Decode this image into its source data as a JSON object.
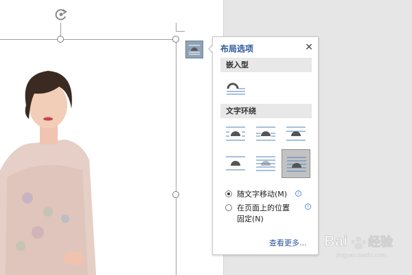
{
  "panel": {
    "title": "布局选项",
    "close_icon": "close-icon",
    "sections": {
      "inline": "嵌入型",
      "wrap": "文字环绕"
    },
    "wrap_options_selected_index": 5,
    "radio_move_with_text": "随文字移动(M)",
    "radio_fix_position_line1": "在页面上的位置",
    "radio_fix_position_line2": "固定(N)",
    "see_more": "查看更多..."
  },
  "watermark": {
    "text": "Bai 经验",
    "subtext": "jingyan.baidu.com"
  },
  "colors": {
    "accent": "#2b579a",
    "selected_option_bg": "#c2c2c2",
    "layout_button_bg": "#8fa3b8"
  }
}
